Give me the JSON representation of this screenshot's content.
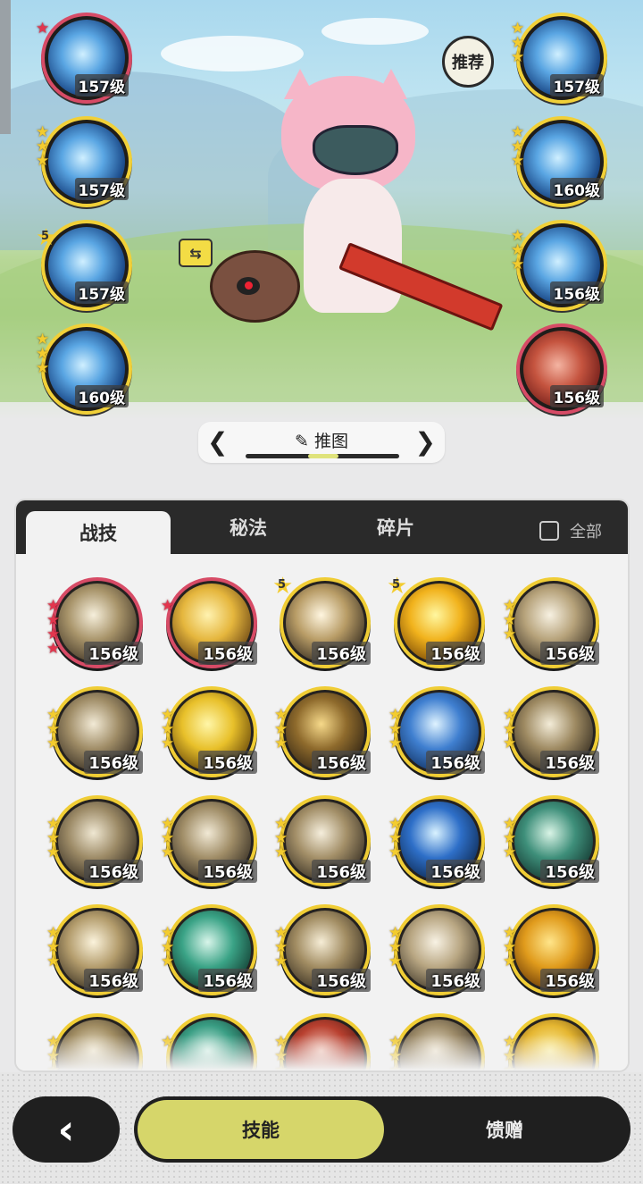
{
  "left_skills": [
    {
      "level": "157级",
      "stars": 1,
      "star_color": "red",
      "ring": "red",
      "style": "water"
    },
    {
      "level": "157级",
      "stars": 3,
      "star_color": "gold",
      "ring": "gold",
      "style": "water"
    },
    {
      "level": "157级",
      "star_badge": "5",
      "ring": "gold",
      "style": "water"
    },
    {
      "level": "160级",
      "stars": 3,
      "star_color": "gold",
      "ring": "gold",
      "style": "ice"
    }
  ],
  "right_skills": [
    {
      "level": "157级",
      "stars": 3,
      "star_color": "gold",
      "ring": "gold",
      "style": "snow"
    },
    {
      "level": "160级",
      "stars": 3,
      "star_color": "gold",
      "ring": "gold",
      "style": "shield"
    },
    {
      "level": "156级",
      "stars": 3,
      "star_color": "gold",
      "ring": "gold",
      "style": "crystal"
    },
    {
      "level": "156级",
      "stars": 0,
      "ring": "red",
      "style": "redshield"
    }
  ],
  "recommend_label": "推荐",
  "swap_icon": "⇆",
  "mode": {
    "left_arrow": "❮",
    "right_arrow": "❯",
    "label": "✎ 推图"
  },
  "tabs": {
    "active": "战技",
    "t2": "秘法",
    "t3": "碎片",
    "all": "全部"
  },
  "grid": [
    {
      "level": "156级",
      "stars": 4,
      "star_color": "red",
      "ring": "red",
      "c1": "#f6efdc",
      "c2": "#a8946a",
      "c3": "#3a2f22"
    },
    {
      "level": "156级",
      "stars": 1,
      "star_color": "red",
      "ring": "red",
      "c1": "#fff2b0",
      "c2": "#e5b63d",
      "c3": "#5e3a10"
    },
    {
      "level": "156级",
      "star_badge": "5",
      "ring": "gold",
      "c1": "#fff6e0",
      "c2": "#b89c66",
      "c3": "#2e261c"
    },
    {
      "level": "156级",
      "star_badge": "5",
      "ring": "gold",
      "c1": "#fff7a0",
      "c2": "#f1b21c",
      "c3": "#6e3f05"
    },
    {
      "level": "156级",
      "stars": 3,
      "star_color": "gold",
      "ring": "gold",
      "c1": "#f7f1e2",
      "c2": "#b6a27a",
      "c3": "#3a3124"
    },
    {
      "level": "156级",
      "stars": 3,
      "star_color": "gold",
      "ring": "gold",
      "c1": "#f2ead6",
      "c2": "#9f8c66",
      "c3": "#30281f"
    },
    {
      "level": "156级",
      "stars": 3,
      "star_color": "gold",
      "ring": "gold",
      "c1": "#fff6a8",
      "c2": "#e8c02a",
      "c3": "#5c3d07"
    },
    {
      "level": "156级",
      "stars": 3,
      "star_color": "gold",
      "ring": "gold",
      "c1": "#f6d98a",
      "c2": "#8e6a2c",
      "c3": "#2a1f12"
    },
    {
      "level": "156级",
      "stars": 3,
      "star_color": "gold",
      "ring": "gold",
      "c1": "#dff3ff",
      "c2": "#3f7fd0",
      "c3": "#0f2c5a"
    },
    {
      "level": "156级",
      "stars": 3,
      "star_color": "gold",
      "ring": "gold",
      "c1": "#f3ecd8",
      "c2": "#9e8a62",
      "c3": "#2c251b"
    },
    {
      "level": "156级",
      "stars": 3,
      "star_color": "gold",
      "ring": "gold",
      "c1": "#efe7d2",
      "c2": "#9c8a66",
      "c3": "#2e271e"
    },
    {
      "level": "156级",
      "stars": 3,
      "star_color": "gold",
      "ring": "gold",
      "c1": "#f1e9d5",
      "c2": "#a08d67",
      "c3": "#2f281f"
    },
    {
      "level": "156级",
      "stars": 3,
      "star_color": "gold",
      "ring": "gold",
      "c1": "#f5eedc",
      "c2": "#a38f68",
      "c3": "#30291f"
    },
    {
      "level": "156级",
      "stars": 3,
      "star_color": "gold",
      "ring": "gold",
      "c1": "#d9f2ff",
      "c2": "#2e6fc8",
      "c3": "#0c2448"
    },
    {
      "level": "156级",
      "stars": 3,
      "star_color": "gold",
      "ring": "gold",
      "c1": "#d9f4e6",
      "c2": "#3e8f7a",
      "c3": "#10302a"
    },
    {
      "level": "156级",
      "stars": 3,
      "star_color": "gold",
      "ring": "gold",
      "c1": "#fbf3dc",
      "c2": "#b39c6c",
      "c3": "#322a1e"
    },
    {
      "level": "156级",
      "stars": 3,
      "star_color": "gold",
      "ring": "gold",
      "c1": "#d8f5ea",
      "c2": "#3aa386",
      "c3": "#0e3329"
    },
    {
      "level": "156级",
      "stars": 3,
      "star_color": "gold",
      "ring": "gold",
      "c1": "#f6edd6",
      "c2": "#a18c62",
      "c3": "#30281d"
    },
    {
      "level": "156级",
      "stars": 3,
      "star_color": "gold",
      "ring": "gold",
      "c1": "#f8f2e4",
      "c2": "#b8a682",
      "c3": "#3a3225"
    },
    {
      "level": "156级",
      "stars": 3,
      "star_color": "gold",
      "ring": "gold",
      "c1": "#ffe58a",
      "c2": "#e09b1c",
      "c3": "#5c2f06"
    },
    {
      "level": "",
      "stars": 3,
      "star_color": "gold",
      "ring": "gold",
      "c1": "#f3ead2",
      "c2": "#a08c62",
      "c3": "#2e271d"
    },
    {
      "level": "",
      "stars": 1,
      "star_color": "gold",
      "ring": "gold",
      "c1": "#d8f4ea",
      "c2": "#3a9e84",
      "c3": "#0e3028"
    },
    {
      "level": "",
      "stars": 3,
      "star_color": "gold",
      "ring": "gold",
      "c1": "#f4c7bb",
      "c2": "#b8402f",
      "c3": "#3a120e"
    },
    {
      "level": "",
      "stars": 3,
      "star_color": "gold",
      "ring": "gold",
      "c1": "#f1e8d4",
      "c2": "#9c8a68",
      "c3": "#2e271e"
    },
    {
      "level": "",
      "stars": 3,
      "star_color": "gold",
      "ring": "gold",
      "c1": "#fff2a4",
      "c2": "#e5b631",
      "c3": "#5a3b08"
    }
  ],
  "bottom": {
    "back": "‹",
    "active": "技能",
    "other": "馈赠"
  }
}
